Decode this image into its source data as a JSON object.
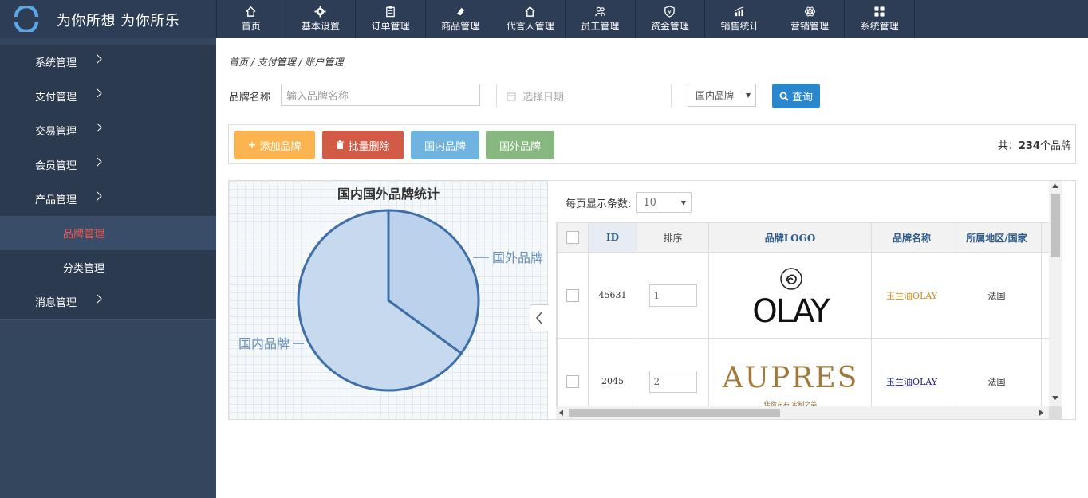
{
  "app": {
    "title": "为你所想 为你所乐",
    "logo_icon": "refresh-ring-icon",
    "brand_color": "#2a87cd"
  },
  "topnav": [
    {
      "label": "首页",
      "icon": "home-icon"
    },
    {
      "label": "基本设置",
      "icon": "gear-icon"
    },
    {
      "label": "订单管理",
      "icon": "clipboard-icon"
    },
    {
      "label": "商品管理",
      "icon": "eraser-icon"
    },
    {
      "label": "代言人管理",
      "icon": "home-icon"
    },
    {
      "label": "员工管理",
      "icon": "users-icon"
    },
    {
      "label": "资金管理",
      "icon": "shield-icon"
    },
    {
      "label": "销售统计",
      "icon": "bar-chart-icon"
    },
    {
      "label": "营销管理",
      "icon": "atom-icon"
    },
    {
      "label": "系统管理",
      "icon": "grid-icon"
    }
  ],
  "sidebar": {
    "items": [
      {
        "label": "系统管理"
      },
      {
        "label": "支付管理"
      },
      {
        "label": "交易管理"
      },
      {
        "label": "会员管理"
      },
      {
        "label": "产品管理"
      }
    ],
    "subitems": [
      {
        "label": "品牌管理",
        "active": true
      },
      {
        "label": "分类管理",
        "active": false
      }
    ],
    "last_item": {
      "label": "消息管理"
    }
  },
  "breadcrumb": "首页 / 支付管理 / 账户管理",
  "search": {
    "brand_label": "品牌名称",
    "brand_placeholder": "输入品牌名称",
    "date_placeholder": "选择日期",
    "type_selected": "国内品牌",
    "search_button": "查询"
  },
  "toolbar": {
    "add_label": "添加品牌",
    "delete_label": "批量删除",
    "domestic_label": "国内品牌",
    "foreign_label": "国外品牌",
    "total_prefix": "共：",
    "total_count": "234",
    "total_suffix": "个品牌"
  },
  "chart_data": {
    "type": "pie",
    "title": "国内国外品牌统计",
    "labels": [
      "国内品牌",
      "国外品牌"
    ],
    "values": [
      65,
      35
    ]
  },
  "table": {
    "page_size_label": "每页显示条数:",
    "page_size": "10",
    "headers": [
      "ID",
      "排序",
      "品牌LOGO",
      "品牌名称",
      "所属地区/国家"
    ],
    "rows": [
      {
        "id": "45631",
        "sort": "1",
        "logo": "OLAY",
        "name": "玉兰油OLAY",
        "region": "法国"
      },
      {
        "id": "2045",
        "sort": "2",
        "logo": "AUPRES",
        "logo_sub": "伴你左右  定制之美",
        "name": "玉兰油OLAY",
        "region": "法国"
      }
    ]
  }
}
